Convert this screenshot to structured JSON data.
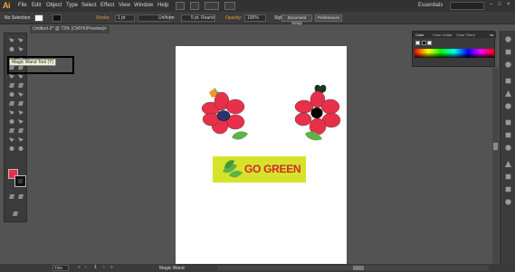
{
  "app": {
    "logo": "Ai",
    "menu": [
      "File",
      "Edit",
      "Object",
      "Type",
      "Select",
      "Effect",
      "View",
      "Window",
      "Help"
    ],
    "workspace": "Essentials",
    "window_controls": [
      "–",
      "□",
      "×"
    ]
  },
  "control_bar": {
    "selection": "No Selection",
    "stroke_label": "Stroke:",
    "stroke_weight": "1 pt",
    "profile": "Uniform",
    "brush": "5 pt. Round",
    "opacity_label": "Opacity:",
    "opacity_value": "100%",
    "style_label": "Style:",
    "document_setup": "Document Setup",
    "preferences": "Preferences"
  },
  "document_tab": {
    "title": "Untitled-2* @ 73% (CMYK/Preview)",
    "close": "×"
  },
  "toolbar": {
    "tooltip": "Magic Wand Tool (Y)",
    "fill_color": "#e8304a",
    "stroke_color": "#111111"
  },
  "artwork": {
    "banner_text": "GO GREEN",
    "flower_petal_color": "#e8304a",
    "flower1_center_color": "#2a3570",
    "flower2_center_color": "#000000",
    "leaf_color": "#5fb04a",
    "banner_bg_color": "#d7e32a",
    "banner_text_color": "#d0282c"
  },
  "color_panel": {
    "tabs": [
      "Color",
      "Color Guide",
      "Color Them"
    ],
    "collapse": "◂◂"
  },
  "status_bar": {
    "zoom": "73%",
    "tool_name": "Magic Wand",
    "artboard_number": "1"
  }
}
